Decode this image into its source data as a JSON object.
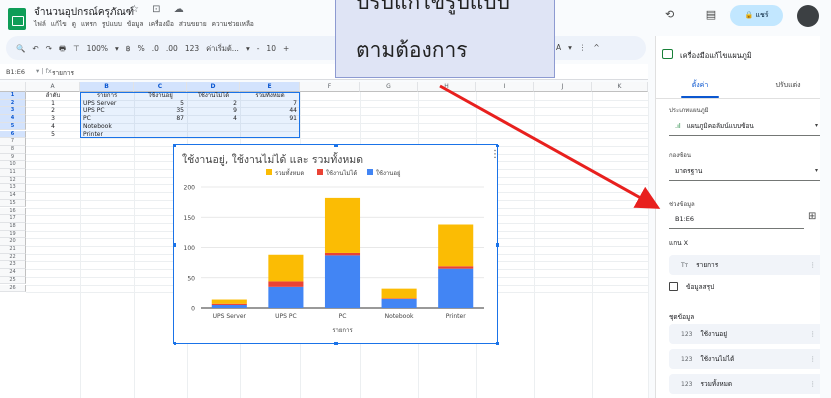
{
  "header": {
    "title": "จำนวนอุปกรณ์ครุภัณฑ์",
    "title_icons": "☆ ⊡ ☁",
    "menu": [
      "ไฟล์",
      "แก้ไข",
      "ดู",
      "แทรก",
      "รูปแบบ",
      "ข้อมูล",
      "เครื่องมือ",
      "ส่วนขยาย",
      "ความช่วยเหลือ"
    ],
    "right_icons": "⟲ ▤ ▢",
    "share_label": "🔒 แชร์"
  },
  "toolbar": {
    "items": [
      "🔍",
      "↶",
      "↷",
      "🖶",
      "⊤",
      "100%",
      "▾",
      "฿",
      "%",
      ".0",
      ".00",
      "123",
      "ค่าเริ่มต้...",
      "▾",
      "-",
      "10",
      "+"
    ],
    "right_items": [
      "A",
      "▾",
      "⋮",
      "^"
    ]
  },
  "formula_bar": {
    "cell_ref": "B1:E6",
    "fx": "▾ | fx",
    "value": "รายการ"
  },
  "sheet": {
    "columns": [
      "A",
      "B",
      "C",
      "D",
      "E",
      "F",
      "G",
      "H",
      "I",
      "J",
      "K"
    ],
    "selected_columns": [
      "B",
      "C",
      "D",
      "E"
    ],
    "row_numbers": [
      "1",
      "2",
      "3",
      "4",
      "5",
      "6",
      "7",
      "8",
      "9",
      "10",
      "11",
      "12",
      "13",
      "14",
      "15",
      "16",
      "17",
      "18",
      "19",
      "20",
      "21",
      "22",
      "23",
      "24",
      "25",
      "26"
    ],
    "rows": [
      [
        "ลำดับ",
        "รายการ",
        "ใช้งานอยู่",
        "ใช้งานไม่ได้",
        "รวมทั้งหมด"
      ],
      [
        "1",
        "UPS Server",
        "5",
        "2",
        "7"
      ],
      [
        "2",
        "UPS PC",
        "35",
        "9",
        "44"
      ],
      [
        "3",
        "PC",
        "87",
        "4",
        "91"
      ],
      [
        "4",
        "Notebook",
        "",
        "",
        ""
      ],
      [
        "5",
        "Printer",
        "",
        "",
        ""
      ]
    ]
  },
  "chart_data": {
    "type": "bar",
    "stacked": true,
    "title": "ใช้งานอยู่, ใช้งานไม่ได้ และ รวมทั้งหมด",
    "categories": [
      "UPS Server",
      "UPS PC",
      "PC",
      "Notebook",
      "Printer"
    ],
    "series": [
      {
        "name": "ใช้งานอยู่",
        "color": "#4285f4",
        "values": [
          5,
          35,
          87,
          15,
          65
        ]
      },
      {
        "name": "ใช้งานไม่ได้",
        "color": "#ea4335",
        "values": [
          2,
          9,
          4,
          1,
          4
        ]
      },
      {
        "name": "รวมทั้งหมด",
        "color": "#fbbc04",
        "values": [
          7,
          44,
          91,
          16,
          69
        ]
      }
    ],
    "legend_order": [
      "รวมทั้งหมด",
      "ใช้งานไม่ได้",
      "ใช้งานอยู่"
    ],
    "xlabel": "รายการ",
    "ylabel": "",
    "yticks": [
      0,
      50,
      100,
      150,
      200
    ],
    "ylim": [
      0,
      200
    ],
    "legend_position": "top",
    "grid": true,
    "menu_icon": "⋮"
  },
  "sidebar": {
    "title": "เครื่องมือแก้ไขแผนภูมิ",
    "close": "×",
    "tab_setup": "ตั้งค่า",
    "tab_customize": "ปรับแต่ง",
    "chart_type_label": "ประเภทแผนภูมิ",
    "chart_type_value": "แผนภูมิคอลัมน์แบบซ้อน",
    "stacking_label": "กองซ้อน",
    "stacking_value": "มาตรฐาน",
    "range_label": "ช่วงข้อมูล",
    "range_value": "B1:E6",
    "xaxis_label": "แกน X",
    "xaxis_value": "รายการ",
    "aggregate_label": "ข้อมูลสรุป",
    "series_label": "ชุดข้อมูล",
    "series": [
      "ใช้งานอยู่",
      "ใช้งานไม่ได้",
      "รวมทั้งหมด"
    ],
    "chip_icon_x": "Tт",
    "chip_icon_num": "123",
    "caret": "▾",
    "dots": "⋮",
    "range_icon": "⊞"
  },
  "callout": {
    "line1": "ตามต้องการ",
    "line0": "ปรับแก้ไขรูปแบบ"
  },
  "colors": {
    "accent": "#1a73e8",
    "arrow": "#e8201e",
    "callout_bg": "#dfe4f5"
  }
}
